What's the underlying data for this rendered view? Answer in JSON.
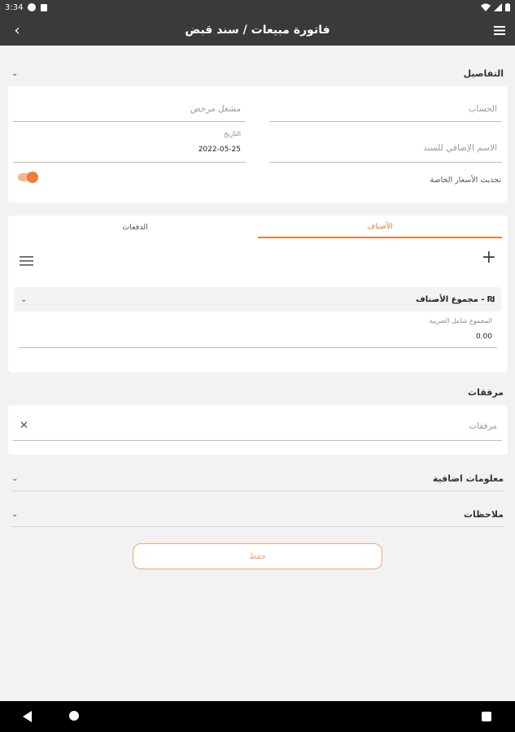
{
  "status": {
    "time": "3:34"
  },
  "app_bar": {
    "title": "فاتورة مبيعات / سند قبض",
    "back_icon": "‹",
    "menu_icon": "≡"
  },
  "details": {
    "title": "التفاصيل",
    "account_placeholder": "الحساب",
    "occupation_placeholder": "مشغل مرخص",
    "extra_name_placeholder": "الاسم الإضافي للسند",
    "date_label": "التاريخ",
    "date_value": "2022-05-25",
    "update_prices_label": "تحديث الأسعار الخاصة",
    "update_prices_on": true
  },
  "tabs": [
    {
      "label": "الأصناف",
      "active": true
    },
    {
      "label": "الدفعات",
      "active": false
    }
  ],
  "items": {
    "add_icon": "+",
    "list_icon": "≡",
    "group_label": "مجموع الأصناف - ₪",
    "total_label": "المجموع شامل الضريبة",
    "total_value": "0.00"
  },
  "attachments": {
    "title": "مرفقات",
    "placeholder": "مرفقات",
    "clear_icon": "✕"
  },
  "extra_info": {
    "title": "معلومات اضافية"
  },
  "notes": {
    "title": "ملاحظات"
  },
  "save": {
    "label": "حفظ"
  },
  "colors": {
    "accent": "#ef7d33",
    "bar": "#3a3a3a"
  }
}
